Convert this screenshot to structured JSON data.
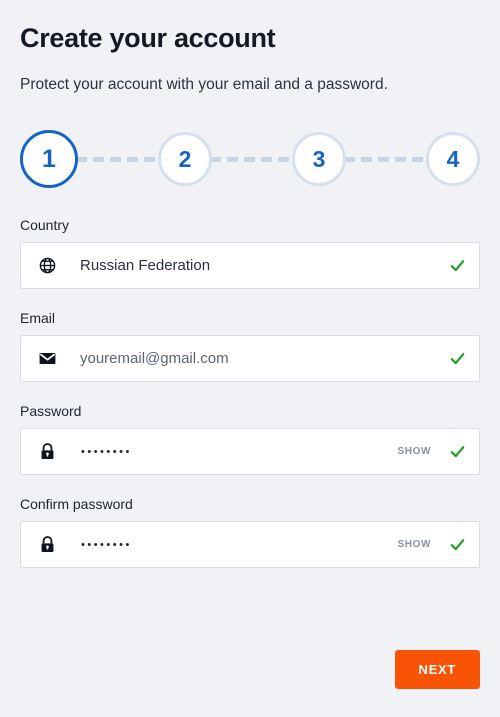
{
  "header": {
    "title": "Create your account",
    "subtitle": "Protect your account with your email and a password."
  },
  "stepper": {
    "current_step": 1,
    "steps": [
      {
        "number": "1",
        "state": "active"
      },
      {
        "number": "2",
        "state": "inactive"
      },
      {
        "number": "3",
        "state": "inactive"
      },
      {
        "number": "4",
        "state": "inactive"
      }
    ],
    "active_color": "#1565c0",
    "inactive_color": "#d5e0ec",
    "connector_color": "#c6d4e3"
  },
  "form": {
    "country": {
      "label": "Country",
      "icon": "globe-icon",
      "value": "Russian Federation",
      "valid": true
    },
    "email": {
      "label": "Email",
      "icon": "envelope-icon",
      "value": "youremail@gmail.com",
      "placeholder": "youremail@gmail.com",
      "valid": true
    },
    "password": {
      "label": "Password",
      "icon": "lock-icon",
      "value": "••••••••",
      "show_label": "SHOW",
      "valid": true
    },
    "confirm_password": {
      "label": "Confirm password",
      "icon": "lock-icon",
      "value": "••••••••",
      "show_label": "SHOW",
      "valid": true
    },
    "valid_color": "#2aa02a"
  },
  "footer": {
    "next_label": "NEXT",
    "next_color": "#f95305"
  },
  "theme": {
    "background": "#f1f2f6",
    "field_background": "#ffffff",
    "text": "#1d2330"
  }
}
